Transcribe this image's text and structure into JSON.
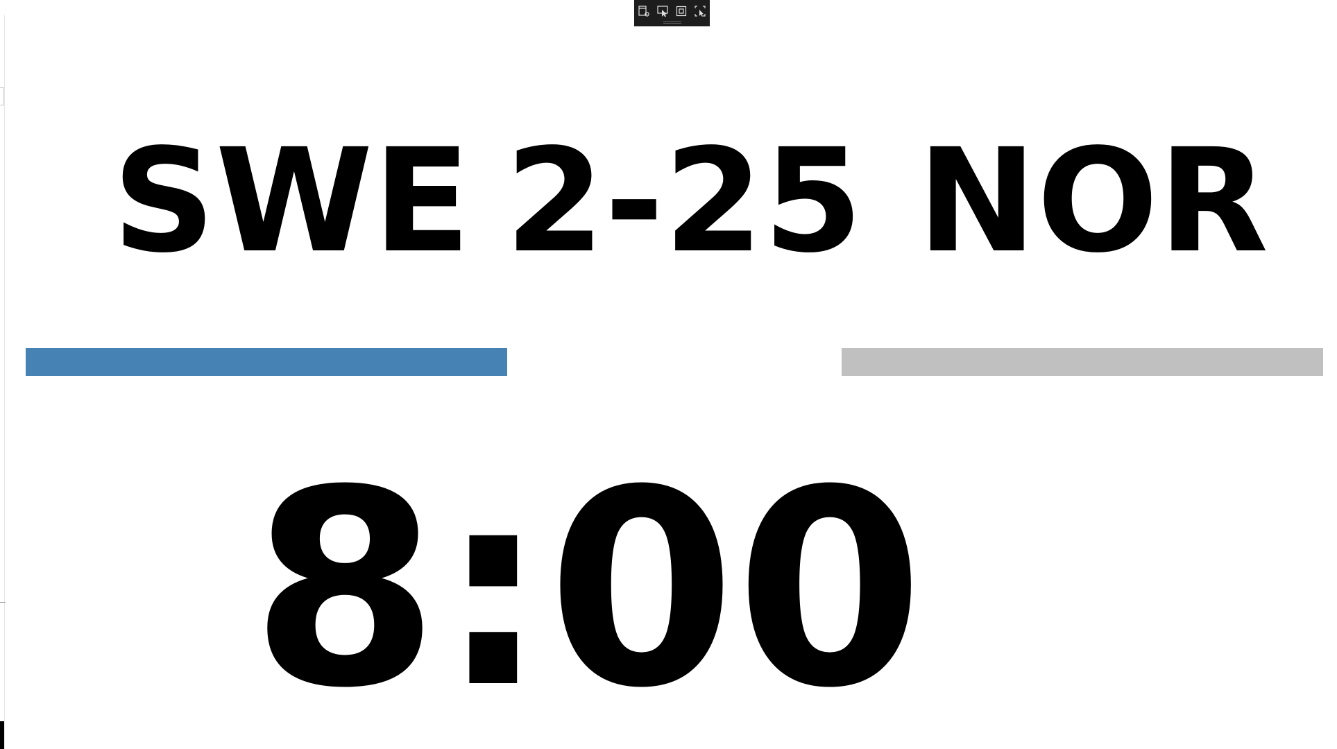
{
  "scoreboard": {
    "home_team": "SWE",
    "score": "2-25",
    "away_team": "NOR",
    "clock": "8:00"
  },
  "bars": {
    "home": {
      "fill": 1.0,
      "color": "#4682b4"
    },
    "away": {
      "fill": 1.0,
      "color": "#c0c0c0"
    }
  },
  "toolbar": {
    "buttons": [
      "window-settings-icon",
      "select-pointer-icon",
      "frame-box-icon",
      "capture-region-icon"
    ]
  },
  "colors": {
    "background": "#ffffff",
    "text": "#000000",
    "toolbar": "#1d1d1d"
  }
}
